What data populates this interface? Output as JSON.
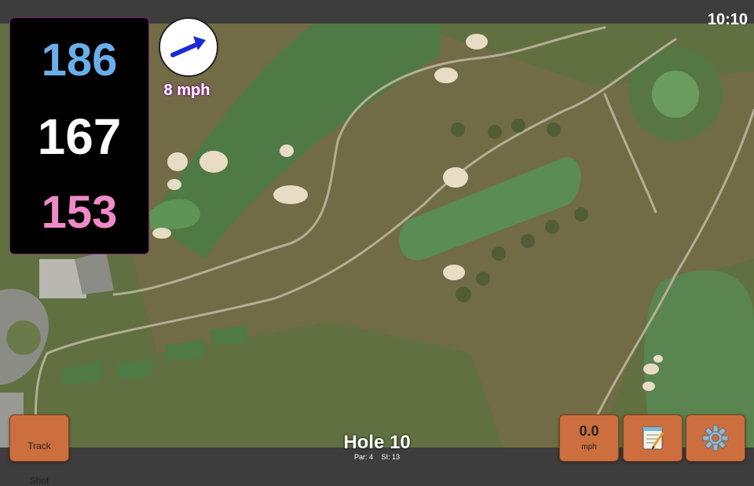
{
  "status": {
    "time": "10:10"
  },
  "yardages": {
    "back": "186",
    "center": "167",
    "front": "153"
  },
  "wind": {
    "speed_label": "8 mph",
    "icon": "wind-arrow-icon"
  },
  "hole": {
    "title": "Hole 10",
    "par": "Par: 4",
    "stroke_index": "SI: 13"
  },
  "buttons": {
    "track_shot": [
      "Track",
      "Shot"
    ],
    "speed_value": "0.0",
    "speed_unit": "mph",
    "notes_icon": "notepad-icon",
    "settings_icon": "gear-icon"
  },
  "colors": {
    "back": "#6aaeea",
    "center": "#ffffff",
    "front": "#f08ac6",
    "button": "#cc6e3e",
    "wind_text_glow": "#8a1a8a"
  }
}
